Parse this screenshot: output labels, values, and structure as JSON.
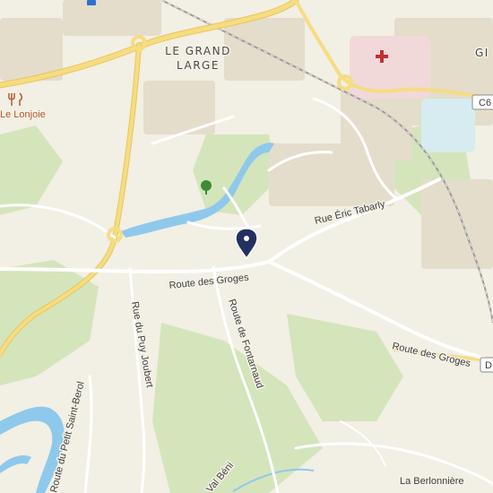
{
  "map": {
    "colors": {
      "background": "#f2efe4",
      "green": "#cfe3b4",
      "forest": "#b6d99c",
      "water": "#8ec9ec",
      "water_edge": "#6fb6e0",
      "major_road": "#f3d577",
      "minor_road": "#ffffff",
      "building": "#e6dfd0",
      "hospital_zone": "#f1d9d9",
      "rail": "#9b9b9b",
      "marker": "#22315f",
      "tree_icon": "#3f8a37",
      "hospital_cross": "#c0322e"
    },
    "labels": {
      "district_line1": "LE GRAND",
      "district_line2": "LARGE",
      "edge_label_top_right": "GI",
      "road_badge_top": "C6",
      "road_badge_right": "D",
      "rue_eric_tabarly": "Rue Éric Tabarly",
      "route_des_groges_1": "Route des Groges",
      "route_des_groges_2": "Route des Groges",
      "rue_du_puy_joubert": "Rue du Puy Joubert",
      "route_de_fontarnaud": "Route de Fontarnaud",
      "route_du_petit_saint_berol": "Route du Petit Saint-Berol",
      "val_beni": "Val Béni",
      "la_berlonniere": "La Berlonnière",
      "restaurant": "Le Lonjoie"
    },
    "icons": {
      "marker": "location-pin-icon",
      "restaurant": "fork-knife-icon",
      "park": "tree-icon",
      "hospital": "hospital-cross-icon",
      "parking": "parking-icon"
    }
  }
}
